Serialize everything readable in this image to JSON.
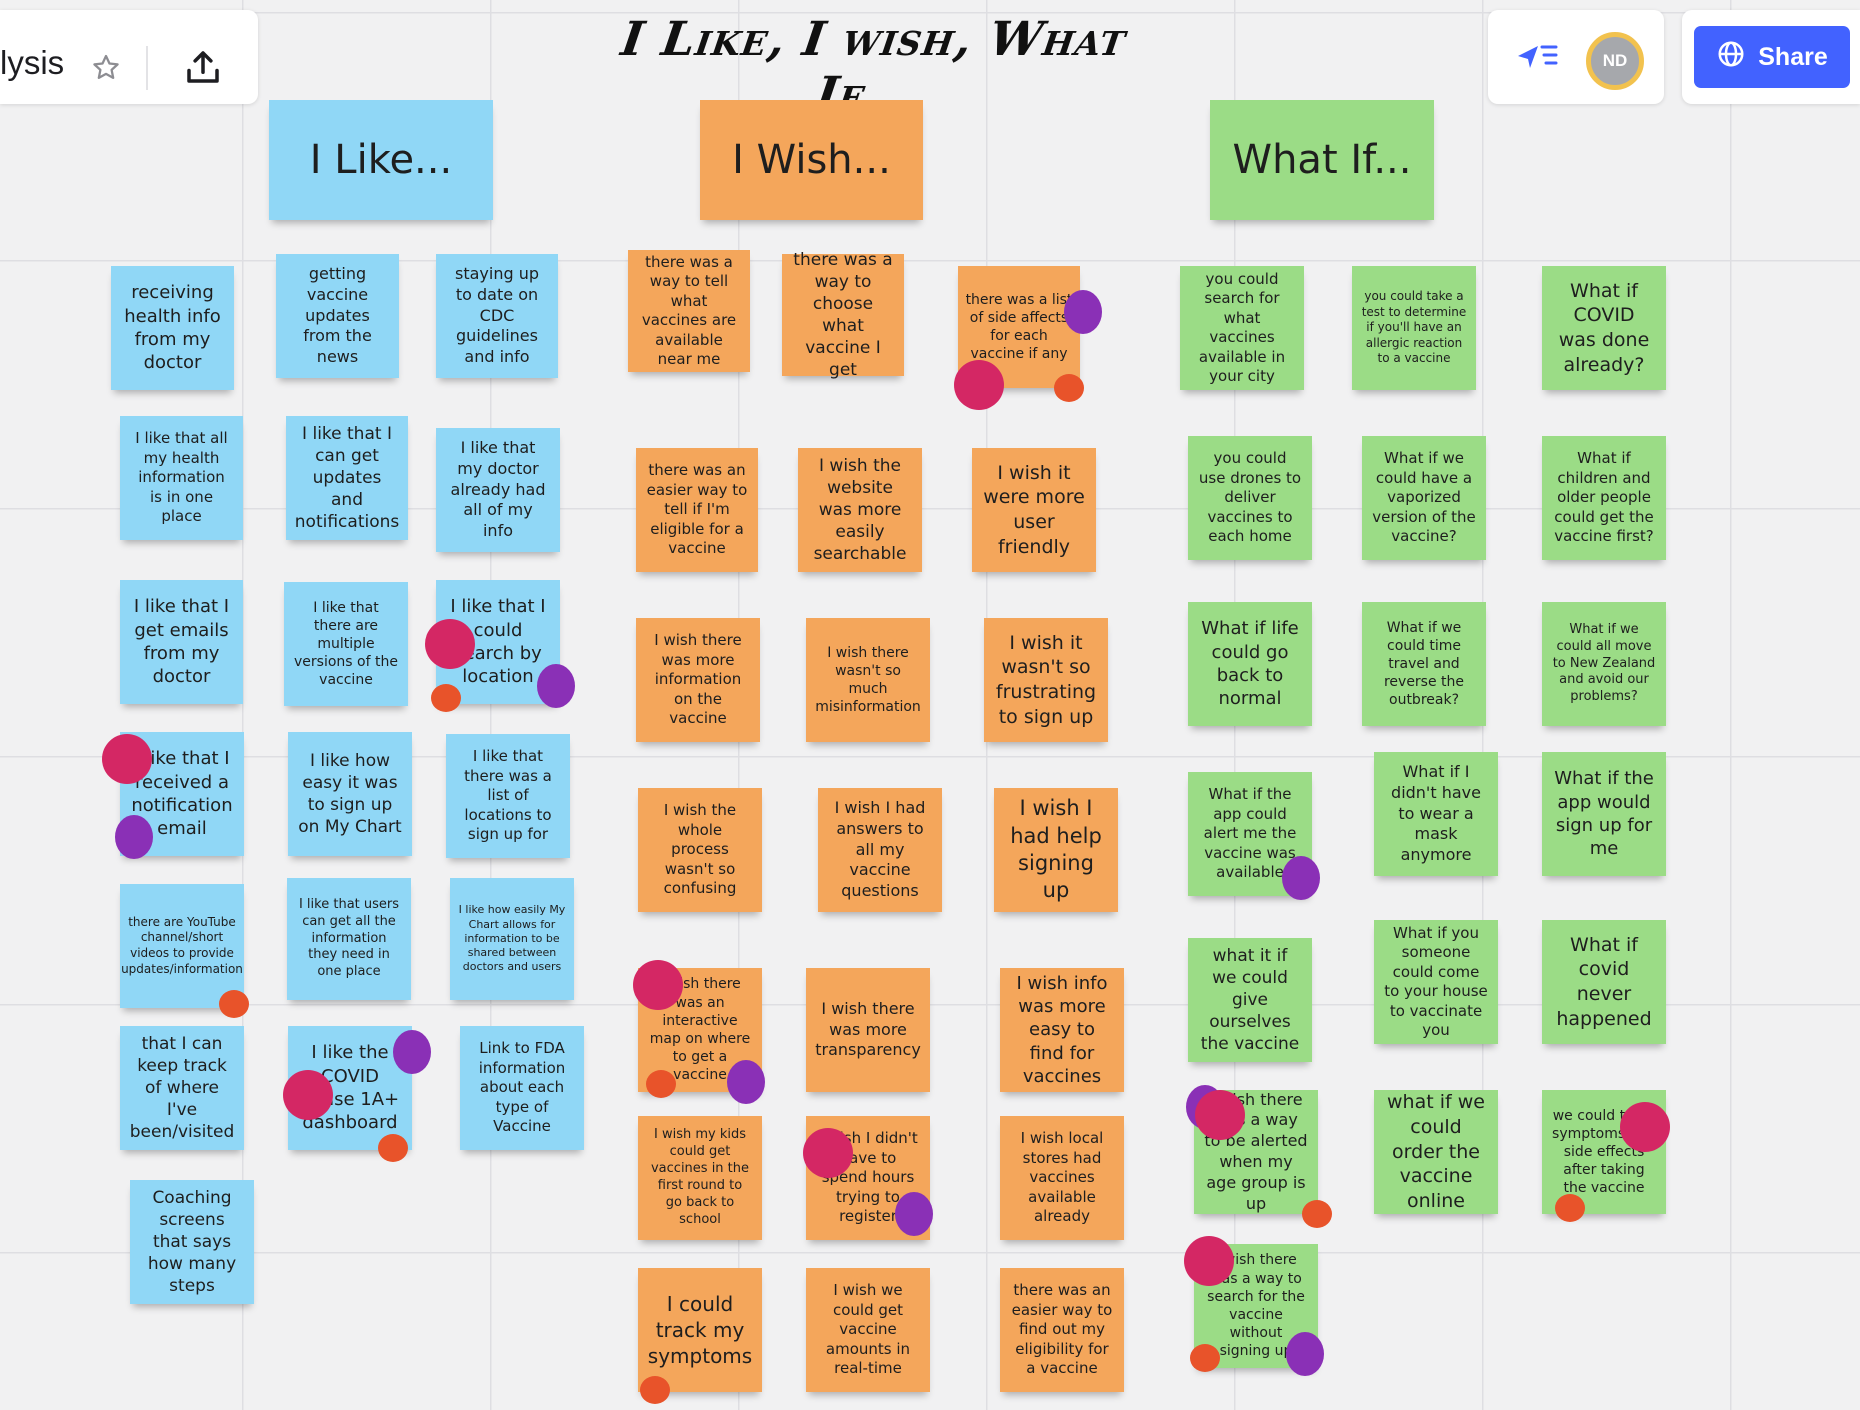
{
  "toolbar": {
    "board_name": "lysis",
    "star_icon": "star-icon",
    "export_icon": "upload-icon"
  },
  "collaboration": {
    "presentation_icon": "cursor-follow-icon",
    "avatar_initials": "ND",
    "share_label": "Share",
    "share_icon": "globe-icon"
  },
  "board": {
    "title": "I Like, I wish, What If..."
  },
  "colors": {
    "blue_sticky": "#90d7f6",
    "orange_sticky": "#f4a65b",
    "green_sticky": "#9bdc86",
    "vote_magenta": "#d42764",
    "vote_purple": "#8a30b6",
    "vote_red": "#e8532a",
    "share_button": "#4262ff"
  },
  "headers": {
    "like": "I Like...",
    "wish": "I Wish...",
    "what_if": "What If..."
  },
  "like_notes": [
    "receiving health info from my doctor",
    "getting vaccine updates from the news",
    "staying up to date on CDC guidelines and info",
    "I like that all my health information is in one place",
    "I like that I can get updates and notifications",
    "I like that my doctor already had all of my info",
    "I like that I get emails from my doctor",
    "I like that there are multiple versions of the vaccine",
    "I like that I could search by location",
    "I like that I received a notification email",
    "I like how easy it was to sign up on My Chart",
    "I like that there was a list of locations to sign up for",
    "there are YouTube channel/short videos to provide updates/information",
    "I like that users can get all the information they need in one place",
    "I like how easily My Chart allows for information to be shared between doctors and users",
    "that I can keep track of where I've been/visited",
    "I like the COVID Phase 1A+ dashboard",
    "Link to FDA information about each type of Vaccine",
    "Coaching screens that says how many steps"
  ],
  "wish_notes": [
    "there was a way to tell what vaccines are available near me",
    "there was a way to choose what vaccine I get",
    "there was a list of side affects for each vaccine if any",
    "there was an easier way to tell if I'm eligible for a vaccine",
    "I wish the website was more easily searchable",
    "I wish it were more user friendly",
    "I wish there was more information on the vaccine",
    "I wish there wasn't so much misinformation",
    "I wish it wasn't so frustrating to sign up",
    "I wish the whole process wasn't so confusing",
    "I wish I had answers to all my vaccine questions",
    "I wish I had help signing up",
    "I wish there was an interactive map on where to get a vaccine",
    "I wish there was more transparency",
    "I wish info was more easy to find for vaccines",
    "I wish my kids could get vaccines in the first round to go back to school",
    "I wish I didn't have to spend hours trying to register",
    "I wish local stores had vaccines available already",
    "I could track my symptoms",
    "I wish we could get vaccine amounts in real-time",
    "there was an easier way to find out my eligibility for a vaccine"
  ],
  "whatif_notes": [
    "you could search for what vaccines available in your city",
    "you could take a test to determine if you'll have an allergic reaction to a vaccine",
    "What if COVID was done already?",
    "you could use drones to deliver vaccines to each home",
    "What if we could have a vaporized version of the vaccine?",
    "What if children and older people could get the vaccine first?",
    "What if life could go back to normal",
    "What if we could time travel and reverse the outbreak?",
    "What if we could all move to New Zealand and avoid our problems?",
    "What if the app could alert me the vaccine was available",
    "What if I didn't have to wear a mask anymore",
    "What if the app would sign up for me",
    "what it if we could give ourselves the vaccine",
    "What if you someone could come to your house to vaccinate you",
    "What if covid never happened",
    "I wish there was a way to be alerted when my age group is up",
    "what if we could order the vaccine online",
    "we could track symptoms and side effects after taking the vaccine",
    "I wish there was a way to search for the vaccine without signing up"
  ]
}
